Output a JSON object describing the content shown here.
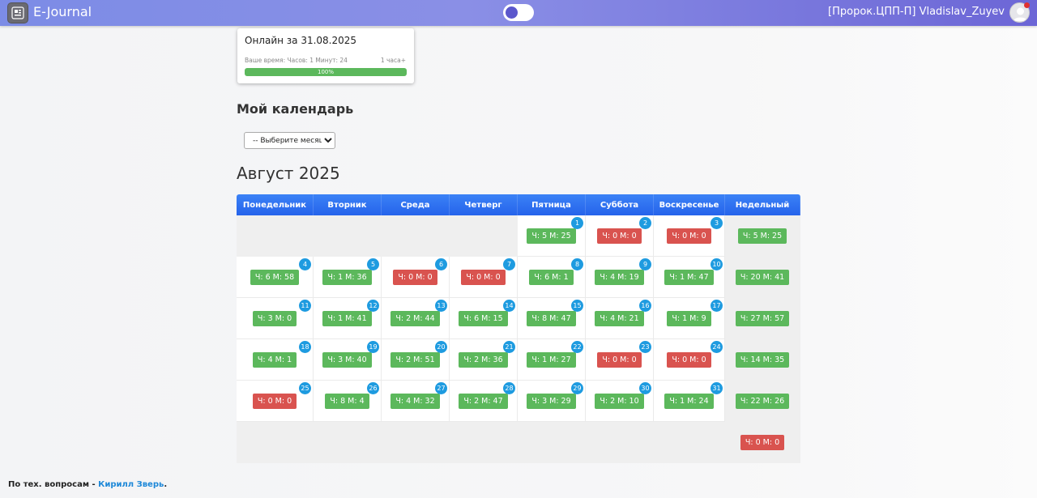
{
  "header": {
    "brand": "E-Journal",
    "user": "[Пророк.ЦПП-П] Vladislav_Zuyev"
  },
  "online_card": {
    "title": "Онлайн за 31.08.2025",
    "time_label": "Ваше время: Часов: 1 Минут: 24",
    "goal_label": "1 часа+",
    "progress_label": "100%",
    "progress_value": 100
  },
  "calendar_section": {
    "title": "Мой календарь",
    "month_select": "-- Выберите месяц --"
  },
  "month_title": "Август 2025",
  "days_of_week": [
    "Понедельник",
    "Вторник",
    "Среда",
    "Четверг",
    "Пятница",
    "Суббота",
    "Воскресенье",
    "Недельный"
  ],
  "weeks": [
    {
      "days": [
        null,
        null,
        null,
        null,
        {
          "num": "1",
          "time": "Ч: 5 М: 25",
          "status": "green"
        },
        {
          "num": "2",
          "time": "Ч: 0 М: 0",
          "status": "red"
        },
        {
          "num": "3",
          "time": "Ч: 0 М: 0",
          "status": "red"
        }
      ],
      "weekly": {
        "time": "Ч: 5 М: 25",
        "status": "green"
      }
    },
    {
      "days": [
        {
          "num": "4",
          "time": "Ч: 6 М: 58",
          "status": "green"
        },
        {
          "num": "5",
          "time": "Ч: 1 М: 36",
          "status": "green"
        },
        {
          "num": "6",
          "time": "Ч: 0 М: 0",
          "status": "red"
        },
        {
          "num": "7",
          "time": "Ч: 0 М: 0",
          "status": "red"
        },
        {
          "num": "8",
          "time": "Ч: 6 М: 1",
          "status": "green"
        },
        {
          "num": "9",
          "time": "Ч: 4 М: 19",
          "status": "green"
        },
        {
          "num": "10",
          "time": "Ч: 1 М: 47",
          "status": "green"
        }
      ],
      "weekly": {
        "time": "Ч: 20 М: 41",
        "status": "green"
      }
    },
    {
      "days": [
        {
          "num": "11",
          "time": "Ч: 3 М: 0",
          "status": "green"
        },
        {
          "num": "12",
          "time": "Ч: 1 М: 41",
          "status": "green"
        },
        {
          "num": "13",
          "time": "Ч: 2 М: 44",
          "status": "green"
        },
        {
          "num": "14",
          "time": "Ч: 6 М: 15",
          "status": "green"
        },
        {
          "num": "15",
          "time": "Ч: 8 М: 47",
          "status": "green"
        },
        {
          "num": "16",
          "time": "Ч: 4 М: 21",
          "status": "green"
        },
        {
          "num": "17",
          "time": "Ч: 1 М: 9",
          "status": "green"
        }
      ],
      "weekly": {
        "time": "Ч: 27 М: 57",
        "status": "green"
      }
    },
    {
      "days": [
        {
          "num": "18",
          "time": "Ч: 4 М: 1",
          "status": "green"
        },
        {
          "num": "19",
          "time": "Ч: 3 М: 40",
          "status": "green"
        },
        {
          "num": "20",
          "time": "Ч: 2 М: 51",
          "status": "green"
        },
        {
          "num": "21",
          "time": "Ч: 2 М: 36",
          "status": "green"
        },
        {
          "num": "22",
          "time": "Ч: 1 М: 27",
          "status": "green"
        },
        {
          "num": "23",
          "time": "Ч: 0 М: 0",
          "status": "red"
        },
        {
          "num": "24",
          "time": "Ч: 0 М: 0",
          "status": "red"
        }
      ],
      "weekly": {
        "time": "Ч: 14 М: 35",
        "status": "green"
      }
    },
    {
      "days": [
        {
          "num": "25",
          "time": "Ч: 0 М: 0",
          "status": "red"
        },
        {
          "num": "26",
          "time": "Ч: 8 М: 4",
          "status": "green"
        },
        {
          "num": "27",
          "time": "Ч: 4 М: 32",
          "status": "green"
        },
        {
          "num": "28",
          "time": "Ч: 2 М: 47",
          "status": "green"
        },
        {
          "num": "29",
          "time": "Ч: 3 М: 29",
          "status": "green"
        },
        {
          "num": "30",
          "time": "Ч: 2 М: 10",
          "status": "green"
        },
        {
          "num": "31",
          "time": "Ч: 1 М: 24",
          "status": "green"
        }
      ],
      "weekly": {
        "time": "Ч: 22 М: 26",
        "status": "green"
      }
    },
    {
      "days": [
        null,
        null,
        null,
        null,
        null,
        null,
        null
      ],
      "weekly": {
        "time": "Ч: 0 М: 0",
        "status": "red"
      }
    }
  ],
  "footer": {
    "text": "По тех. вопросам - ",
    "link": "Кирилл Зверь",
    "suffix": "."
  }
}
